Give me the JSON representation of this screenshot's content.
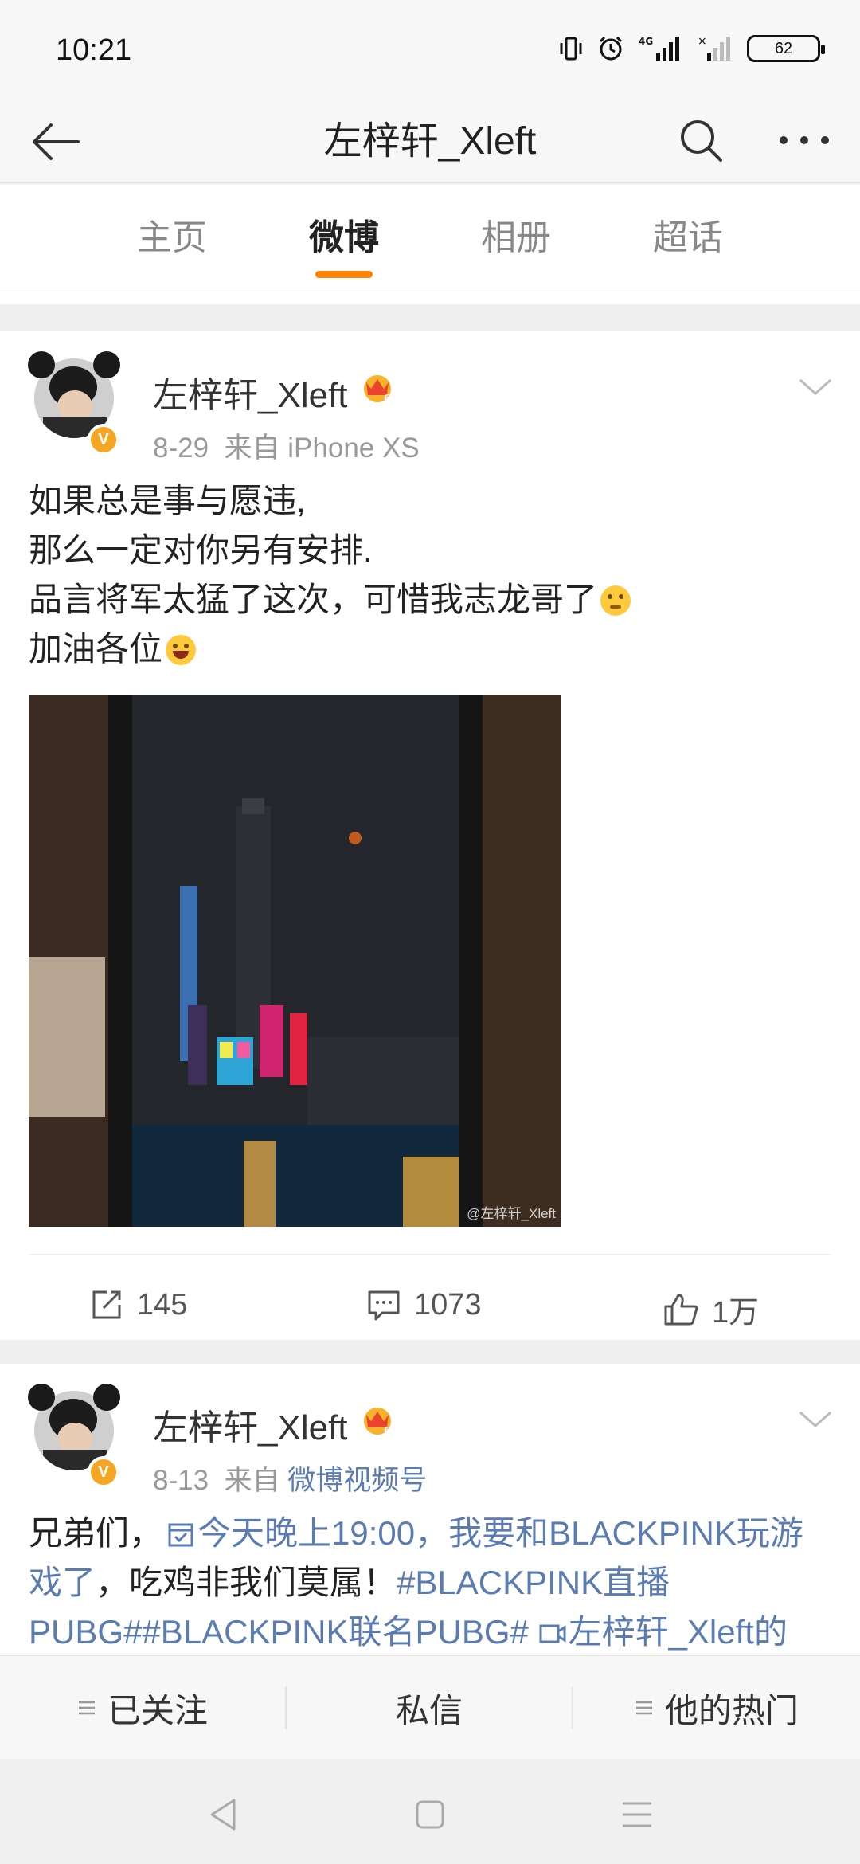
{
  "status_bar": {
    "time": "10:21",
    "battery": "62"
  },
  "header": {
    "title": "左梓轩_Xleft"
  },
  "tabs": [
    {
      "label": "主页"
    },
    {
      "label": "微博"
    },
    {
      "label": "相册"
    },
    {
      "label": "超话"
    }
  ],
  "active_tab": "微博",
  "posts": [
    {
      "username": "左梓轩_Xleft",
      "date": "8-29",
      "source_prefix": "来自",
      "source": "iPhone XS",
      "lines": [
        "如果总是事与愿违,",
        "那么一定对你另有安排.",
        "品言将军太猛了这次，可惜我志龙哥了",
        "加油各位"
      ],
      "image_watermark": "@左梓轩_Xleft",
      "actions": {
        "repost": "145",
        "comment": "1073",
        "like": "1万"
      }
    },
    {
      "username": "左梓轩_Xleft",
      "date": "8-13",
      "source_prefix": "来自",
      "source": "微博视频号",
      "text_plain1": "兄弟们，",
      "link1": "今天晚上19:00，我要和BLACKPINK玩游戏了",
      "text_plain2": "，吃鸡非我们莫属！",
      "link2": "#BLACKPINK直播PUBG##BLACKPINK联名PUBG#",
      "link3": "左梓轩_Xleft的"
    }
  ],
  "bottom_bar": {
    "following": "已关注",
    "message": "私信",
    "hot": "他的热门"
  },
  "colors": {
    "accent": "#ff8200",
    "link": "#5b7cb1",
    "verified": "#f5a623"
  }
}
